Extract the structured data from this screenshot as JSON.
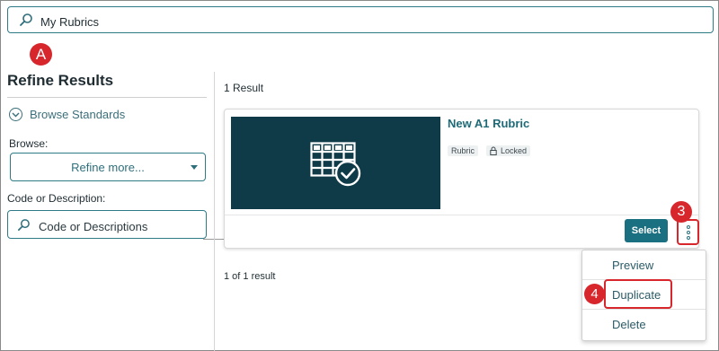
{
  "search": {
    "value": "My Rubrics",
    "icon": "search-icon"
  },
  "callouts": {
    "a": "A",
    "three": "3",
    "four": "4"
  },
  "sidebar": {
    "title": "Refine Results",
    "browse_standards": "Browse Standards",
    "browse_label": "Browse:",
    "browse_select": "Refine more...",
    "code_label": "Code or Description:",
    "code_placeholder": "Code or Descriptions"
  },
  "results": {
    "count": "1 Result",
    "pagination": "1 of 1 result",
    "items": [
      {
        "title": "New A1 Rubric",
        "tags": [
          "Rubric",
          "Locked"
        ],
        "select_label": "Select",
        "thumbnail_icon": "rubric-icon"
      }
    ]
  },
  "menu": {
    "items": [
      "Preview",
      "Duplicate",
      "Delete"
    ]
  },
  "colors": {
    "accent": "#1a6f80",
    "callout": "#d7262c",
    "thumb_bg": "#0e3b47"
  }
}
